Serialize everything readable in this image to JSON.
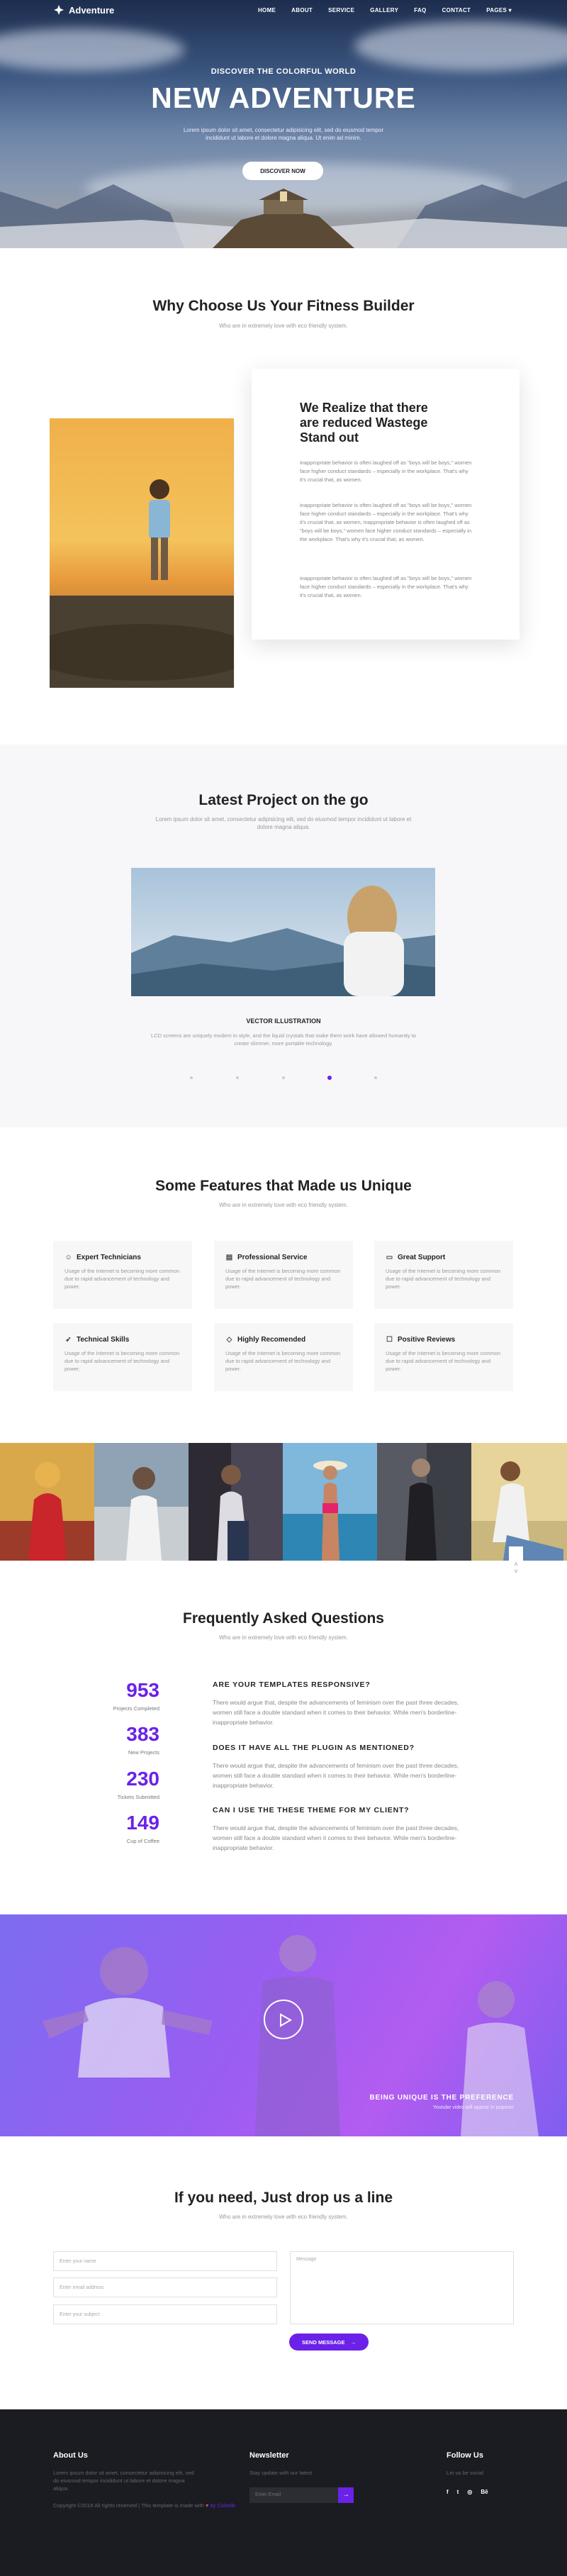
{
  "nav": {
    "brand": "Adventure",
    "links": [
      "HOME",
      "ABOUT",
      "SERVICE",
      "GALLERY",
      "FAQ",
      "CONTACT",
      "PAGES"
    ]
  },
  "hero": {
    "subtitle": "DISCOVER THE COLORFUL WORLD",
    "title": "NEW ADVENTURE",
    "text": "Lorem ipsum dolor sit amet, consectetur adipisicing elit, sed do eiusmod tempor incididunt ut labore et dolore magna aliqua. Ut enim ad minim.",
    "button": "DISCOVER NOW"
  },
  "why": {
    "title": "Why Choose Us Your Fitness Builder",
    "subtitle": "Who are in extremely love with eco friendly system.",
    "card_title": "We Realize that there are reduced Wastege Stand out",
    "paragraphs": [
      "inappropriate behavior is often laughed off as \"boys will be boys,\" women face higher conduct standards – especially in the workplace. That's why it's crucial that, as women.",
      "inappropriate behavior is often laughed off as \"boys will be boys,\" women face higher conduct standards – especially in the workplace. That's why it's crucial that, as women, inappropriate behavior is often laughed off as \"boys will be boys,\" women face higher conduct standards – especially in the workplace. That's why it's crucial that, as women.",
      "inappropriate behavior is often laughed off as \"boys will be boys,\" women face higher conduct standards – especially in the workplace. That's why it's crucial that, as women."
    ]
  },
  "project": {
    "title": "Latest Project on the go",
    "subtitle": "Lorem ipsum dolor sit amet, consectetur adipisicing elit, sed do eiusmod tempor incididunt ut labore et dolore magna aliqua.",
    "caption_title": "VECTOR ILLUSTRATION",
    "caption_text": "LCD screens are uniquely modern in style, and the liquid crystals that make them work have allowed humanity to create slimmer, more portable technology."
  },
  "features": {
    "title": "Some Features that Made us Unique",
    "subtitle": "Who are in extremely love with eco friendly system.",
    "items": [
      {
        "icon": "user-icon",
        "title": "Expert Technicians",
        "text": "Usage of the Internet is becoming more common due to rapid advancement of technology and power."
      },
      {
        "icon": "document-icon",
        "title": "Professional Service",
        "text": "Usage of the Internet is becoming more common due to rapid advancement of technology and power."
      },
      {
        "icon": "monitor-icon",
        "title": "Great Support",
        "text": "Usage of the Internet is becoming more common due to rapid advancement of technology and power."
      },
      {
        "icon": "rocket-icon",
        "title": "Technical Skills",
        "text": "Usage of the Internet is becoming more common due to rapid advancement of technology and power."
      },
      {
        "icon": "diamond-icon",
        "title": "Highly Recomended",
        "text": "Usage of the Internet is becoming more common due to rapid advancement of technology and power."
      },
      {
        "icon": "chat-icon",
        "title": "Positive Reviews",
        "text": "Usage of the Internet is becoming more common due to rapid advancement of technology and power."
      }
    ]
  },
  "faq": {
    "title": "Frequently Asked Questions",
    "subtitle": "Who are in extremely love with eco friendly system.",
    "stats": [
      {
        "num": "953",
        "label": "Projects Completed"
      },
      {
        "num": "383",
        "label": "New Projects"
      },
      {
        "num": "230",
        "label": "Tickets Submitted"
      },
      {
        "num": "149",
        "label": "Cup of Coffee"
      }
    ],
    "items": [
      {
        "q": "ARE YOUR TEMPLATES RESPONSIVE?",
        "a": "There would argue that, despite the advancements of feminism over the past three decades, women still face a double standard when it comes to their behavior. While men's borderline-inappropriate behavior."
      },
      {
        "q": "DOES IT HAVE ALL THE PLUGIN AS MENTIONED?",
        "a": "There would argue that, despite the advancements of feminism over the past three decades, women still face a double standard when it comes to their behavior. While men's borderline-inappropriate behavior."
      },
      {
        "q": "CAN I USE THE THESE THEME FOR MY CLIENT?",
        "a": "There would argue that, despite the advancements of feminism over the past three decades, women still face a double standard when it comes to their behavior. While men's borderline-inappropriate behavior."
      }
    ]
  },
  "video": {
    "title": "BEING UNIQUE IS THE PREFERENCE",
    "subtitle": "Youtube video will appear in popover"
  },
  "contact": {
    "title": "If you need, Just drop us a line",
    "subtitle": "Who are in extremely love with eco friendly system.",
    "name_placeholder": "Enter your name",
    "email_placeholder": "Enter email address",
    "subject_placeholder": "Enter your subject",
    "message_placeholder": "Message",
    "button": "SEND MESSAGE"
  },
  "footer": {
    "about_title": "About Us",
    "about_text": "Lorem ipsum dolor sit amet, consectetur adipisicing elit, sed do eiusmod tempor incididunt ut labore et dolore magna aliqua.",
    "copyright": "Copyright ©2018 All rights reserved | This template is made with",
    "by": "by Colorlib",
    "newsletter_title": "Newsletter",
    "newsletter_text": "Stay update with our latest",
    "email_placeholder": "Enter Email",
    "follow_title": "Follow Us",
    "follow_text": "Let us be social"
  },
  "colors": {
    "accent": "#6b21e8",
    "footer_bg": "#1a1c21"
  }
}
